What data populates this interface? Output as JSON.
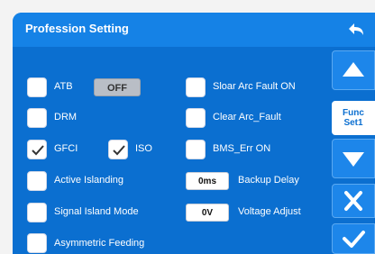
{
  "header": {
    "title": "Profession Setting"
  },
  "settings": {
    "atb": {
      "label": "ATB",
      "checked": false,
      "toggle_value": "OFF"
    },
    "drm": {
      "label": "DRM",
      "checked": false
    },
    "gfci": {
      "label": "GFCI",
      "checked": true
    },
    "iso": {
      "label": "ISO",
      "checked": true
    },
    "active_islanding": {
      "label": "Active Islanding",
      "checked": false
    },
    "signal_island_mode": {
      "label": "Signal Island Mode",
      "checked": false
    },
    "asymmetric_feeding": {
      "label": "Asymmetric Feeding",
      "checked": false
    },
    "solar_arc_fault_on": {
      "label": "Sloar Arc Fault ON",
      "checked": false
    },
    "clear_arc_fault": {
      "label": "Clear Arc_Fault",
      "checked": false
    },
    "bms_err_on": {
      "label": "BMS_Err ON",
      "checked": false
    },
    "backup_delay": {
      "label": "Backup Delay",
      "value": "0ms"
    },
    "voltage_adjust": {
      "label": "Voltage Adjust",
      "value": "0V"
    }
  },
  "sidebar": {
    "func_line1": "Func",
    "func_line2": "Set1",
    "icons": [
      "back-arrow-icon",
      "up-arrow-icon",
      "down-arrow-icon",
      "close-icon",
      "check-icon"
    ]
  },
  "colors": {
    "background": "#0b6fd0",
    "titlebar": "#1582e6",
    "toggle_off": "#b9bec6"
  }
}
